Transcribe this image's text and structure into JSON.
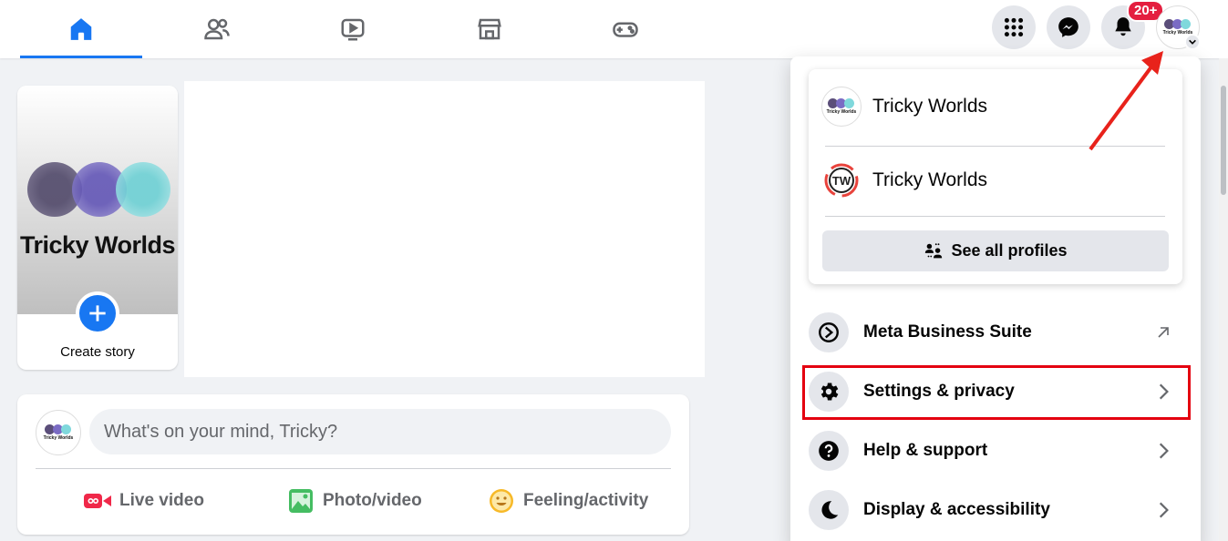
{
  "nav": {
    "tabs": [
      {
        "name": "home-icon",
        "active": true
      },
      {
        "name": "friends-icon",
        "active": false
      },
      {
        "name": "watch-icon",
        "active": false
      },
      {
        "name": "marketplace-icon",
        "active": false
      },
      {
        "name": "gaming-icon",
        "active": false
      }
    ],
    "right": {
      "menu_icon": "grid-menu-icon",
      "messenger_icon": "messenger-icon",
      "notifications_icon": "bell-icon",
      "notifications_badge": "20+"
    },
    "accent_color": "#1877f2",
    "badge_color": "#e41e3f"
  },
  "profile": {
    "logo_text": "Tricky Worlds"
  },
  "story": {
    "title": "Tricky Worlds",
    "label": "Create story"
  },
  "composer": {
    "placeholder": "What's on your mind, Tricky?",
    "actions": [
      {
        "label": "Live video",
        "icon": "live-video-icon",
        "color": "#f02849"
      },
      {
        "label": "Photo/video",
        "icon": "photo-icon",
        "color": "#45bd62"
      },
      {
        "label": "Feeling/activity",
        "icon": "feeling-icon",
        "color": "#f7b928"
      }
    ]
  },
  "menu": {
    "profiles": [
      {
        "name": "Tricky Worlds",
        "avatar": "tricky-worlds-logo"
      },
      {
        "name": "Tricky Worlds",
        "avatar": "tw-logo"
      }
    ],
    "see_all_label": "See all profiles",
    "items": [
      {
        "label": "Meta Business Suite",
        "icon": "meta-business-icon",
        "trail": "external-arrow-icon"
      },
      {
        "label": "Settings & privacy",
        "icon": "gear-icon",
        "trail": "chevron-right-icon"
      },
      {
        "label": "Help & support",
        "icon": "help-icon",
        "trail": "chevron-right-icon"
      },
      {
        "label": "Display & accessibility",
        "icon": "moon-icon",
        "trail": "chevron-right-icon"
      }
    ],
    "highlight_color": "#e4000f"
  },
  "annotation": {
    "arrow_color": "#e8221b"
  }
}
